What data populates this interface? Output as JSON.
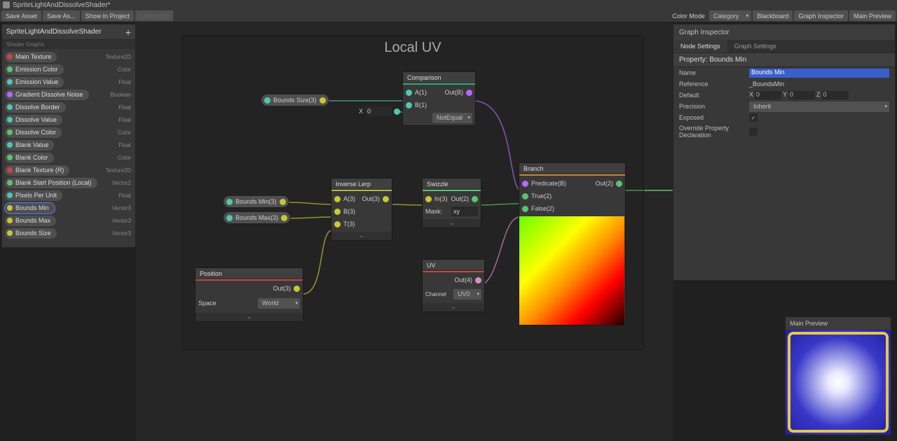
{
  "titlebar": "SpriteLightAndDissolveShader*",
  "toolbar": {
    "save": "Save Asset",
    "saveAs": "Save As...",
    "showInProject": "Show In Project",
    "checkOut": "Check Out",
    "colorModeLabel": "Color Mode",
    "colorModeValue": "Category",
    "blackboard": "Blackboard",
    "graphInspector": "Graph Inspector",
    "mainPreview": "Main Preview"
  },
  "blackboard": {
    "title": "SpriteLightAndDissolveShader",
    "subtitle": "Shader Graphs",
    "props": [
      {
        "name": "Main Texture",
        "type": "Texture2D",
        "color": "#c84444"
      },
      {
        "name": "Emission Color",
        "type": "Color",
        "color": "#5cc46e"
      },
      {
        "name": "Emission Value",
        "type": "Float",
        "color": "#4ec9b0"
      },
      {
        "name": "Gradient Dissolve Noise",
        "type": "Boolean",
        "color": "#b469ff"
      },
      {
        "name": "Dissolve Border",
        "type": "Float",
        "color": "#4ec9b0"
      },
      {
        "name": "Dissolve Value",
        "type": "Float",
        "color": "#4ec9b0"
      },
      {
        "name": "Dissolve Color",
        "type": "Color",
        "color": "#5cc46e"
      },
      {
        "name": "Blank Value",
        "type": "Float",
        "color": "#4ec9b0"
      },
      {
        "name": "Blank Color",
        "type": "Color",
        "color": "#5cc46e"
      },
      {
        "name": "Blank Texture (R)",
        "type": "Texture2D",
        "color": "#c84444"
      },
      {
        "name": "Blank Start Position (Local)",
        "type": "Vector2",
        "color": "#5cc46e"
      },
      {
        "name": "Pixels Per Unit",
        "type": "Float",
        "color": "#4ec9b0"
      },
      {
        "name": "Bounds Min",
        "type": "Vector3",
        "color": "#c8c832",
        "sel": true
      },
      {
        "name": "Bounds Max",
        "type": "Vector3",
        "color": "#c8c832"
      },
      {
        "name": "Bounds Size",
        "type": "Vector3",
        "color": "#c8c832"
      }
    ]
  },
  "group": {
    "title": "Local UV"
  },
  "chips": {
    "boundsSize": "Bounds Size(3)",
    "boundsMin": "Bounds Min(3)",
    "boundsMax": "Bounds Max(3)"
  },
  "nodes": {
    "comparison": {
      "title": "Comparison",
      "a": "A(1)",
      "b": "B(1)",
      "out": "Out(B)",
      "xLabel": "X",
      "xVal": "0",
      "dd": "NotEqual"
    },
    "inverseLerp": {
      "title": "Inverse Lerp",
      "a": "A(3)",
      "b": "B(3)",
      "t": "T(3)",
      "out": "Out(3)"
    },
    "swizzle": {
      "title": "Swizzle",
      "in": "In(3)",
      "out": "Out(2)",
      "maskLabel": "Mask:",
      "maskVal": "xy"
    },
    "branch": {
      "title": "Branch",
      "pred": "Predicate(B)",
      "true": "True(2)",
      "false": "False(2)",
      "out": "Out(2)"
    },
    "position": {
      "title": "Position",
      "out": "Out(3)",
      "spaceLabel": "Space",
      "spaceVal": "World"
    },
    "uv": {
      "title": "UV",
      "out": "Out(4)",
      "channelLabel": "Channel",
      "channelVal": "UV0"
    }
  },
  "inspector": {
    "title": "Graph Inspector",
    "tabs": {
      "node": "Node Settings",
      "graph": "Graph Settings"
    },
    "section": "Property: Bounds Min",
    "rows": {
      "nameLabel": "Name",
      "nameVal": "Bounds Min",
      "refLabel": "Reference",
      "refVal": "_BoundsMin",
      "defLabel": "Default",
      "x": "X",
      "xv": "0",
      "y": "Y",
      "yv": "0",
      "z": "Z",
      "zv": "0",
      "precLabel": "Precision",
      "precVal": "Inherit",
      "expLabel": "Exposed",
      "ovrLabel": "Override Property Declaration"
    }
  },
  "mainPreview": {
    "title": "Main Preview"
  }
}
